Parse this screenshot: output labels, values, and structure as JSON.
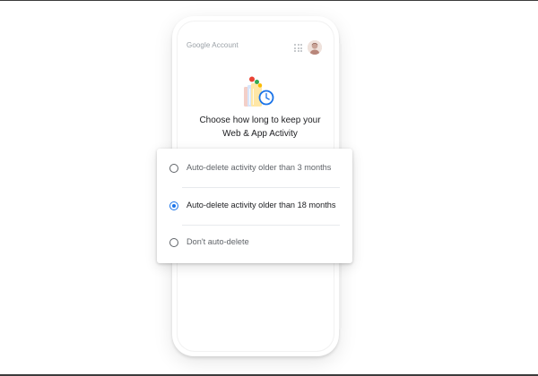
{
  "header": {
    "title": "Google Account",
    "apps_icon": "apps-grid-icon",
    "avatar_icon": "account-avatar-icon"
  },
  "illustration_icon": "history-clock-illustration",
  "prompt": {
    "line1": "Choose how long to keep your",
    "line2": "Web & App Activity"
  },
  "options": [
    {
      "label": "Auto-delete activity older than 3 months",
      "selected": false
    },
    {
      "label": "Auto-delete activity older than 18 months",
      "selected": true
    },
    {
      "label": "Don't auto-delete",
      "selected": false
    }
  ],
  "colors": {
    "accent": "#1a73e8",
    "text_primary": "#202124",
    "text_secondary": "#5f6368",
    "muted": "#9aa0a6"
  }
}
